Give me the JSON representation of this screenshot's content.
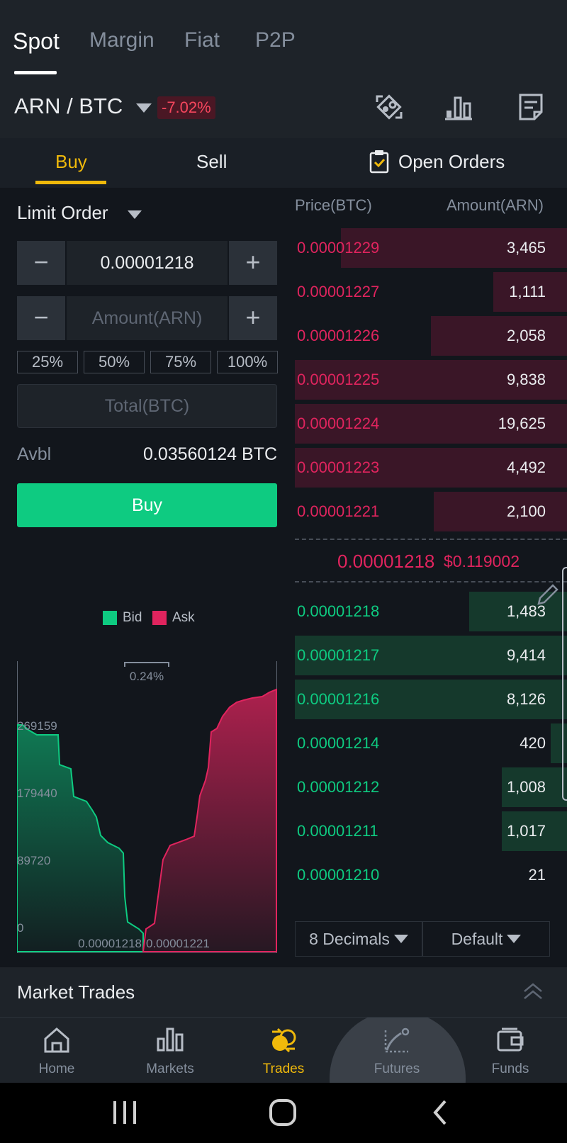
{
  "top_tabs": [
    "Spot",
    "Margin",
    "Fiat",
    "P2P"
  ],
  "pair": {
    "name": "ARN / BTC",
    "change": "-7.02%"
  },
  "trade_tabs": {
    "buy": "Buy",
    "sell": "Sell",
    "open_orders": "Open Orders"
  },
  "order_form": {
    "order_type": "Limit Order",
    "price_value": "0.00001218",
    "amount_placeholder": "Amount(ARN)",
    "percentages": [
      "25%",
      "50%",
      "75%",
      "100%"
    ],
    "total_placeholder": "Total(BTC)",
    "avbl_label": "Avbl",
    "avbl_value": "0.03560124 BTC",
    "submit_label": "Buy"
  },
  "depth_chart": {
    "legend": {
      "bid": "Bid",
      "ask": "Ask"
    },
    "spread": "0.24%",
    "y_ticks": [
      "269159",
      "179440",
      "89720",
      "0"
    ],
    "x_ticks": [
      "0.00001218",
      "0.00001221"
    ]
  },
  "order_book": {
    "price_header": "Price(BTC)",
    "amount_header": "Amount(ARN)",
    "asks": [
      {
        "price": "0.00001229",
        "amount": "3,465",
        "depth": 0.83
      },
      {
        "price": "0.00001227",
        "amount": "1,111",
        "depth": 0.27
      },
      {
        "price": "0.00001226",
        "amount": "2,058",
        "depth": 0.5
      },
      {
        "price": "0.00001225",
        "amount": "9,838",
        "depth": 1.0
      },
      {
        "price": "0.00001224",
        "amount": "19,625",
        "depth": 1.0
      },
      {
        "price": "0.00001223",
        "amount": "4,492",
        "depth": 1.0
      },
      {
        "price": "0.00001221",
        "amount": "2,100",
        "depth": 0.49
      }
    ],
    "last_price": "0.00001218",
    "last_price_usd": "$0.119002",
    "bids": [
      {
        "price": "0.00001218",
        "amount": "1,483",
        "depth": 0.36
      },
      {
        "price": "0.00001217",
        "amount": "9,414",
        "depth": 1.0
      },
      {
        "price": "0.00001216",
        "amount": "8,126",
        "depth": 1.0
      },
      {
        "price": "0.00001214",
        "amount": "420",
        "depth": 0.06
      },
      {
        "price": "0.00001212",
        "amount": "1,008",
        "depth": 0.24
      },
      {
        "price": "0.00001211",
        "amount": "1,017",
        "depth": 0.24
      },
      {
        "price": "0.00001210",
        "amount": "21",
        "depth": 0.0
      }
    ],
    "decimals": "8 Decimals",
    "view_mode": "Default"
  },
  "market_trades": {
    "title": "Market Trades"
  },
  "bottom_nav": {
    "items": [
      "Home",
      "Markets",
      "Trades",
      "Futures",
      "Funds"
    ],
    "active": "Trades"
  },
  "colors": {
    "bid": "#0ecb81",
    "ask": "#e0245e",
    "accent": "#f0b90b",
    "background": "#12161c"
  }
}
